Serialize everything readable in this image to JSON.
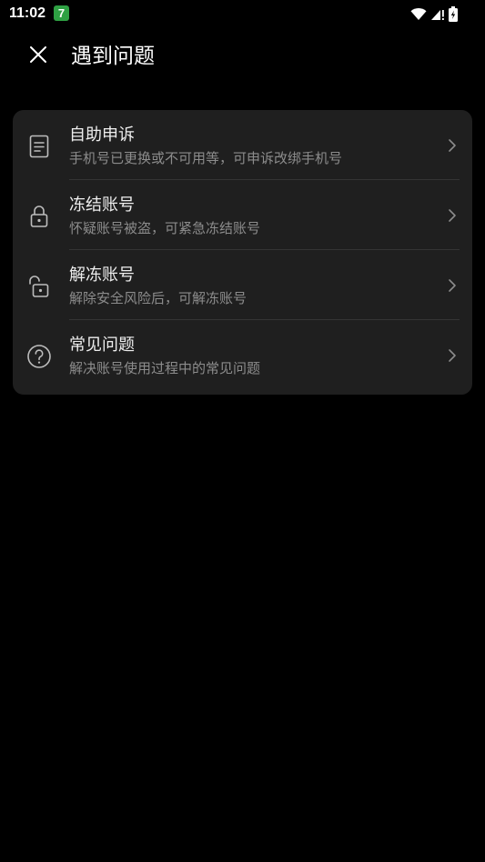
{
  "status_bar": {
    "time": "11:02",
    "app_badge": "7",
    "icons": [
      "wifi-icon",
      "signal-icon",
      "battery-charging-icon"
    ]
  },
  "header": {
    "close_icon": "close-icon",
    "title": "遇到问题"
  },
  "menu": {
    "items": [
      {
        "icon": "document-icon",
        "title": "自助申诉",
        "subtitle": "手机号已更换或不可用等，可申诉改绑手机号"
      },
      {
        "icon": "lock-icon",
        "title": "冻结账号",
        "subtitle": "怀疑账号被盗，可紧急冻结账号"
      },
      {
        "icon": "unlock-icon",
        "title": "解冻账号",
        "subtitle": "解除安全风险后，可解冻账号"
      },
      {
        "icon": "help-circle-icon",
        "title": "常见问题",
        "subtitle": "解决账号使用过程中的常见问题"
      }
    ]
  },
  "colors": {
    "background": "#000000",
    "card": "#1f1f1f",
    "title_text": "#eeeeee",
    "subtitle_text": "#8c8c8c",
    "icon": "#bdbdbd",
    "divider": "#343434",
    "badge": "#2ea043"
  }
}
